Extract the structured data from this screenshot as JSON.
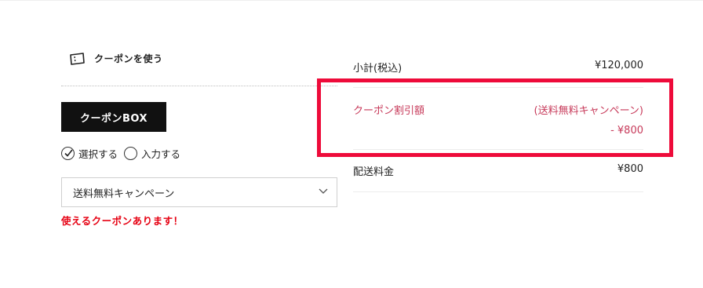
{
  "coupon": {
    "heading": "クーポンを使う",
    "box_button": "クーポンBOX",
    "radio_select": "選択する",
    "radio_input": "入力する",
    "selected_coupon": "送料無料キャンペーン",
    "note": "使えるクーポンあります！"
  },
  "summary": {
    "subtotal_label": "小計(税込)",
    "subtotal_value": "¥120,000",
    "discount_label": "クーポン割引額",
    "discount_name": "(送料無料キャンペーン)",
    "discount_value": "- ¥800",
    "shipping_label": "配送料金",
    "shipping_value": "¥800"
  },
  "colors": {
    "highlight": "#ee0b3a",
    "discount_text": "#c73a5a",
    "note_red": "#e60012"
  },
  "icons": [
    "ticket-icon",
    "check-icon",
    "chevron-down-icon"
  ]
}
